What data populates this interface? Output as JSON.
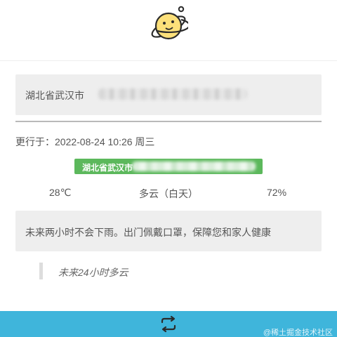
{
  "header": {
    "logo_icon": "planet-face-icon"
  },
  "location": {
    "label": "湖北省武汉市"
  },
  "update": {
    "text": "更行于：2022-08-24 10:26 周三"
  },
  "badge": {
    "label": "湖北省武汉市"
  },
  "stats": {
    "temperature": "28℃",
    "condition": "多云（白天）",
    "humidity": "72%"
  },
  "rain": {
    "text": "未来两小时不会下雨。出门佩戴口罩，保障您和家人健康"
  },
  "forecast": {
    "text": "未来24小时多云"
  },
  "footer": {
    "refresh_icon": "refresh-arrows-icon",
    "watermark": "@稀土掘金技术社区"
  },
  "colors": {
    "accent": "#3fb5db",
    "badge_green": "#5cb85c",
    "logo_yellow": "#fce07a",
    "panel_gray": "#eeeeee"
  }
}
